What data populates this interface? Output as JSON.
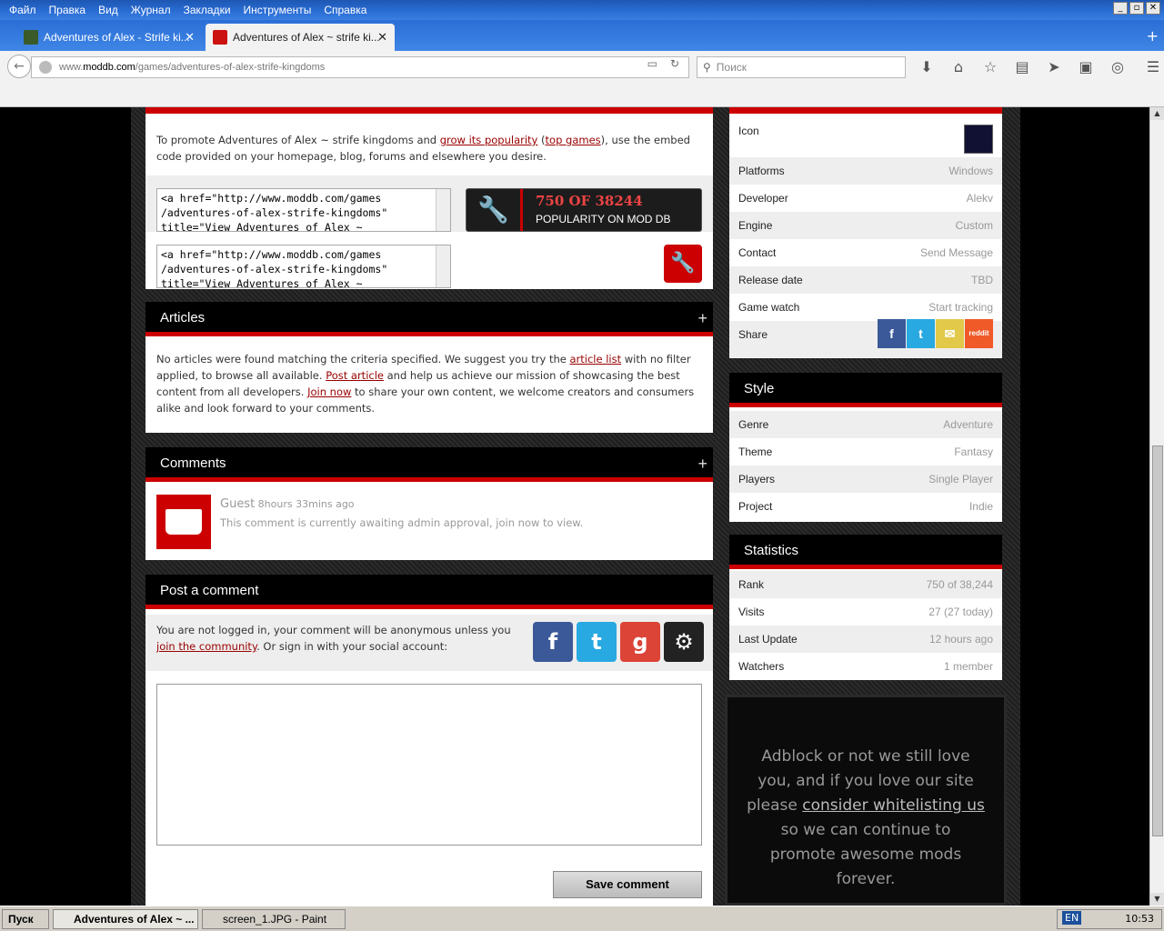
{
  "menu": [
    "Файл",
    "Правка",
    "Вид",
    "Журнал",
    "Закладки",
    "Инструменты",
    "Справка"
  ],
  "tabs": [
    {
      "label": "Adventures of Alex - Strife ki..."
    },
    {
      "label": "Adventures of Alex ~ strife ki..."
    }
  ],
  "url": {
    "prefix": "www.",
    "domain": "moddb.com",
    "path": "/games/adventures-of-alex-strife-kingdoms"
  },
  "search": {
    "placeholder": "Поиск"
  },
  "embed": {
    "intro_pre": "To promote Adventures of Alex ~ strife kingdoms and ",
    "link1": "grow its popularity",
    "mid": " (",
    "link2": "top games",
    "intro_post": "), use the embed code provided on your homepage, blog, forums and elsewhere you desire.",
    "code": "<a href=\"http://www.moddb.com/games\n/adventures-of-alex-strife-kingdoms\"\ntitle=\"View Adventures of Alex ~",
    "badge_value": "750 OF 38244",
    "badge_sub": "POPULARITY ON MOD DB"
  },
  "articles": {
    "title": "Articles",
    "t1": "No articles were found matching the criteria specified. We suggest you try the ",
    "l1": "article list",
    "t2": " with no filter applied, to browse all available. ",
    "l2": "Post article",
    "t3": " and help us achieve our mission of showcasing the best content from all developers. ",
    "l3": "Join now",
    "t4": " to share your own content, we welcome creators and consumers alike and look forward to your comments."
  },
  "comments": {
    "title": "Comments",
    "author": "Guest",
    "time": " 8hours 33mins ago",
    "message": "This comment is currently awaiting admin approval, join now to view."
  },
  "post": {
    "title": "Post a comment",
    "t1": "You are not logged in, your comment will be anonymous unless you ",
    "l1": "join the community",
    "t2": ". Or sign in with your social account:",
    "save": "Save comment"
  },
  "profile": [
    {
      "k": "Icon",
      "v": ""
    },
    {
      "k": "Platforms",
      "v": "Windows"
    },
    {
      "k": "Developer",
      "v": "Alekv"
    },
    {
      "k": "Engine",
      "v": "Custom"
    },
    {
      "k": "Contact",
      "v": "Send Message"
    },
    {
      "k": "Release date",
      "v": "TBD"
    },
    {
      "k": "Game watch",
      "v": "Start tracking"
    },
    {
      "k": "Share",
      "v": ""
    }
  ],
  "share_reddit": "reddit",
  "style": {
    "title": "Style",
    "rows": [
      {
        "k": "Genre",
        "v": "Adventure"
      },
      {
        "k": "Theme",
        "v": "Fantasy"
      },
      {
        "k": "Players",
        "v": "Single Player"
      },
      {
        "k": "Project",
        "v": "Indie"
      }
    ]
  },
  "stats": {
    "title": "Statistics",
    "rows": [
      {
        "k": "Rank",
        "v": "750 of 38,244"
      },
      {
        "k": "Visits",
        "v": "27 (27 today)"
      },
      {
        "k": "Last Update",
        "v": "12 hours ago"
      },
      {
        "k": "Watchers",
        "v": "1 member"
      }
    ]
  },
  "ad": {
    "t1": "Adblock or not we still love you, and if you love our site please ",
    "link": "consider whitelisting us",
    "t2": " so we can continue to promote awesome mods forever."
  },
  "taskbar": {
    "start": "Пуск",
    "task1": "Adventures of Alex ~ ...",
    "task2": "screen_1.JPG - Paint",
    "lang": "EN",
    "clock": "10:53"
  }
}
